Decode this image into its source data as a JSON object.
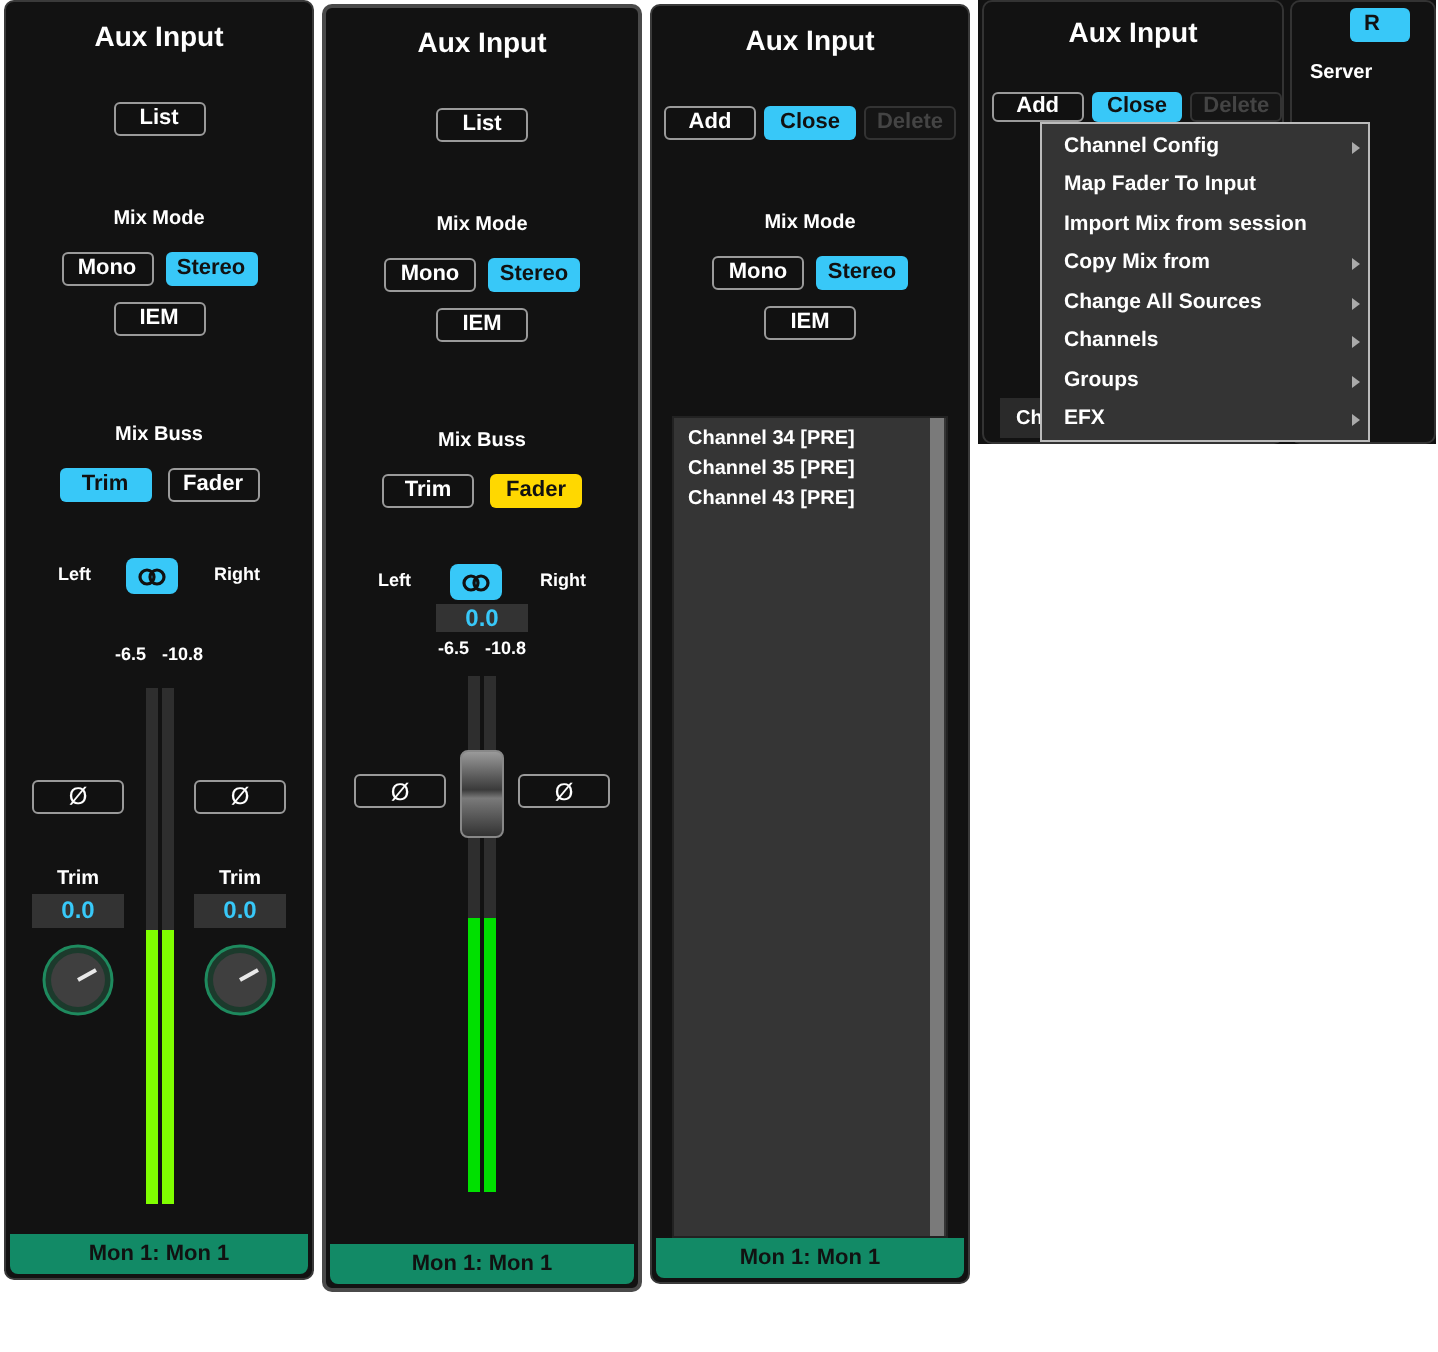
{
  "panels": [
    {
      "kind": "trim",
      "title": "Aux Input",
      "top_buttons": [
        {
          "label": "List",
          "selected": false,
          "disabled": false
        }
      ],
      "mix_mode": {
        "label": "Mix Mode",
        "options": [
          {
            "label": "Mono",
            "selected": false
          },
          {
            "label": "Stereo",
            "selected": true
          },
          {
            "label": "IEM",
            "selected": false
          }
        ]
      },
      "mix_buss": {
        "label": "Mix Buss",
        "options": [
          {
            "label": "Trim",
            "selected": true
          },
          {
            "label": "Fader",
            "selected": false
          }
        ]
      },
      "link": {
        "left": "Left",
        "right": "Right",
        "on": true
      },
      "readings": [
        "-6.5",
        "-10.8"
      ],
      "phase": [
        "Ø",
        "Ø"
      ],
      "trims": [
        {
          "label": "Trim",
          "value": "0.0"
        },
        {
          "label": "Trim",
          "value": "0.0"
        }
      ],
      "meters": [
        {
          "level": 0.53
        },
        {
          "level": 0.53
        }
      ],
      "footer": "Mon 1: Mon 1"
    },
    {
      "kind": "fader",
      "title": "Aux Input",
      "top_buttons": [
        {
          "label": "List",
          "selected": false,
          "disabled": false
        }
      ],
      "mix_mode": {
        "label": "Mix Mode",
        "options": [
          {
            "label": "Mono",
            "selected": false
          },
          {
            "label": "Stereo",
            "selected": true
          },
          {
            "label": "IEM",
            "selected": false
          }
        ]
      },
      "mix_buss": {
        "label": "Mix Buss",
        "options": [
          {
            "label": "Trim",
            "selected": false
          },
          {
            "label": "Fader",
            "selected": true
          }
        ]
      },
      "link": {
        "left": "Left",
        "right": "Right",
        "on": true
      },
      "fader_value": "0.0",
      "readings": [
        "-6.5",
        "-10.8"
      ],
      "phase": [
        "Ø",
        "Ø"
      ],
      "fader": {
        "level": 0.77
      },
      "meters": [
        {
          "level": 0.53
        },
        {
          "level": 0.53
        }
      ],
      "footer": "Mon 1: Mon 1"
    },
    {
      "kind": "list",
      "title": "Aux Input",
      "top_buttons": [
        {
          "label": "Add",
          "selected": false,
          "disabled": false
        },
        {
          "label": "Close",
          "selected": true,
          "disabled": false
        },
        {
          "label": "Delete",
          "selected": false,
          "disabled": true
        }
      ],
      "mix_mode": {
        "label": "Mix Mode",
        "options": [
          {
            "label": "Mono",
            "selected": false
          },
          {
            "label": "Stereo",
            "selected": true
          },
          {
            "label": "IEM",
            "selected": false
          }
        ]
      },
      "channels": [
        "Channel 34 [PRE]",
        "Channel 35 [PRE]",
        "Channel 43 [PRE]"
      ],
      "footer": "Mon 1: Mon 1"
    },
    {
      "kind": "menu",
      "title": "Aux Input",
      "top_buttons": [
        {
          "label": "Add",
          "selected": false,
          "disabled": false
        },
        {
          "label": "Close",
          "selected": true,
          "disabled": false
        },
        {
          "label": "Delete",
          "selected": false,
          "disabled": true
        }
      ],
      "row_text": "Ch",
      "side": {
        "button": "R",
        "label": "Server"
      },
      "menu": [
        {
          "label": "Channel Config",
          "submenu": true
        },
        {
          "label": "Map Fader To Input",
          "submenu": false
        },
        {
          "label": "Import Mix from session",
          "submenu": false
        },
        {
          "label": "Copy Mix from",
          "submenu": true
        },
        {
          "label": "Change All Sources",
          "submenu": true
        },
        {
          "label": "Channels",
          "submenu": true
        },
        {
          "label": "Groups",
          "submenu": true
        },
        {
          "label": "EFX",
          "submenu": true
        }
      ]
    }
  ]
}
